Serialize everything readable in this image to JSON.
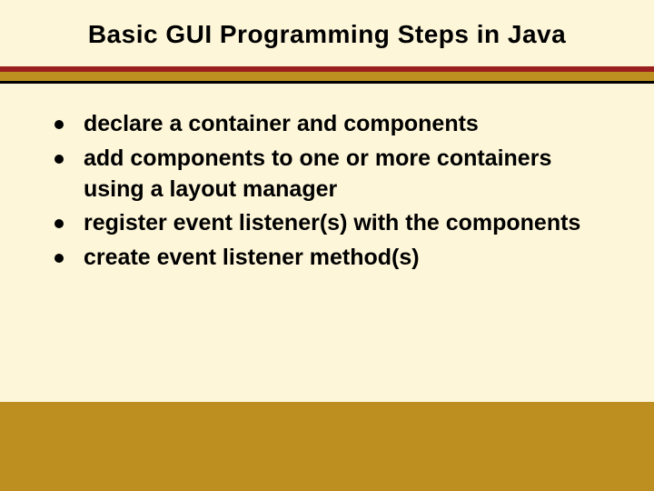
{
  "title": "Basic GUI Programming Steps in Java",
  "bullets": [
    "declare a container and components",
    "add components to one or more containers using a layout manager",
    "register event listener(s) with the components",
    "create event listener method(s)"
  ]
}
